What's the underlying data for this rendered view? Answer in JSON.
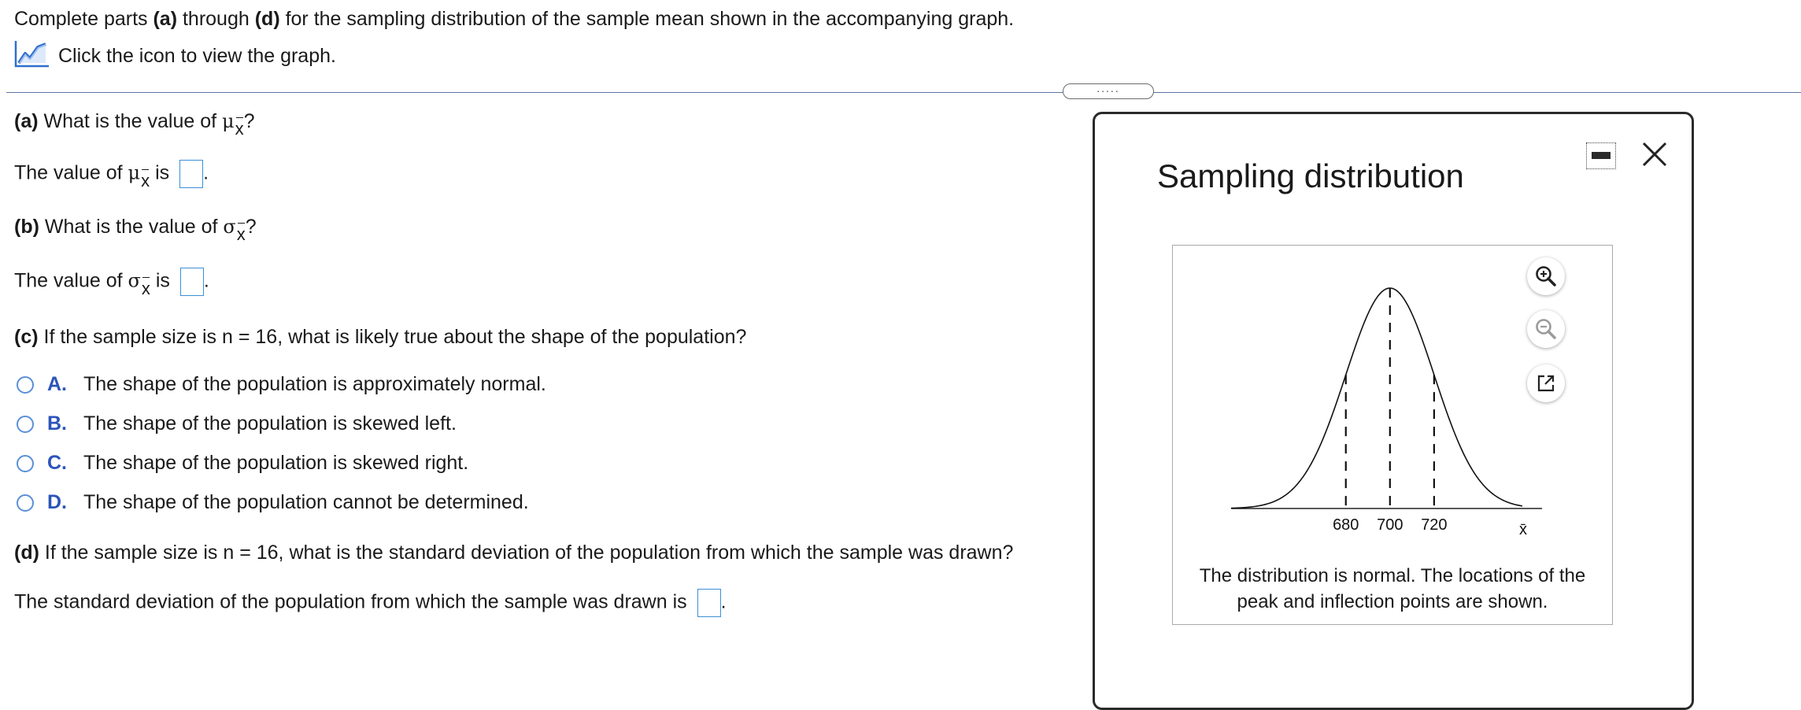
{
  "intro": {
    "line1_pre": "Complete parts ",
    "line1_a": "(a)",
    "line1_mid": " through ",
    "line1_d": "(d)",
    "line1_post": " for the sampling distribution of the sample mean shown in the accompanying graph.",
    "line2": "Click the icon to view the graph.",
    "graph_icon": "line-graph-icon"
  },
  "divider_handle": ".....",
  "symbols": {
    "mu": "μ",
    "sigma": "σ",
    "xbar": "x"
  },
  "parts": {
    "a": {
      "label": "(a)",
      "question_pre": " What is the value of ",
      "question_post": "?",
      "answer_pre": "The value of ",
      "answer_post": " is"
    },
    "b": {
      "label": "(b)",
      "question_pre": " What is the value of ",
      "question_post": "?",
      "answer_pre": "The value of ",
      "answer_post": " is"
    },
    "c": {
      "label": "(c)",
      "question": " If the sample size is n = 16, what is likely true about the shape of the population?"
    },
    "d": {
      "label": "(d)",
      "question": " If the sample size is n = 16, what is the standard deviation of the population from which the sample was drawn?",
      "answer": "The standard deviation of the population from which the sample was drawn is"
    }
  },
  "options": [
    {
      "letter": "A.",
      "text": "The shape of the population is approximately normal."
    },
    {
      "letter": "B.",
      "text": "The shape of the population is skewed left."
    },
    {
      "letter": "C.",
      "text": "The shape of the population is skewed right."
    },
    {
      "letter": "D.",
      "text": "The shape of the population cannot be determined."
    }
  ],
  "period": ".",
  "popup": {
    "title": "Sampling distribution",
    "caption_line1": "The distribution is normal. The locations of the",
    "caption_line2": "peak and inflection points are shown.",
    "minimize_icon": "minimize-icon",
    "close_icon": "close-icon",
    "zoom_in_icon": "zoom-in-icon",
    "zoom_out_icon": "zoom-out-icon",
    "popout_icon": "popout-icon"
  },
  "chart_data": {
    "type": "line",
    "title": "",
    "xlabel": "x̄",
    "ylabel": "",
    "mean": 700,
    "sd": 20,
    "xlim": [
      628,
      760
    ],
    "tick_labels": [
      "680",
      "700",
      "720"
    ],
    "tick_values": [
      680,
      700,
      720
    ],
    "dashed_lines_at": [
      680,
      700,
      720
    ],
    "description_series": [
      {
        "name": "",
        "shape": "normal"
      }
    ]
  }
}
